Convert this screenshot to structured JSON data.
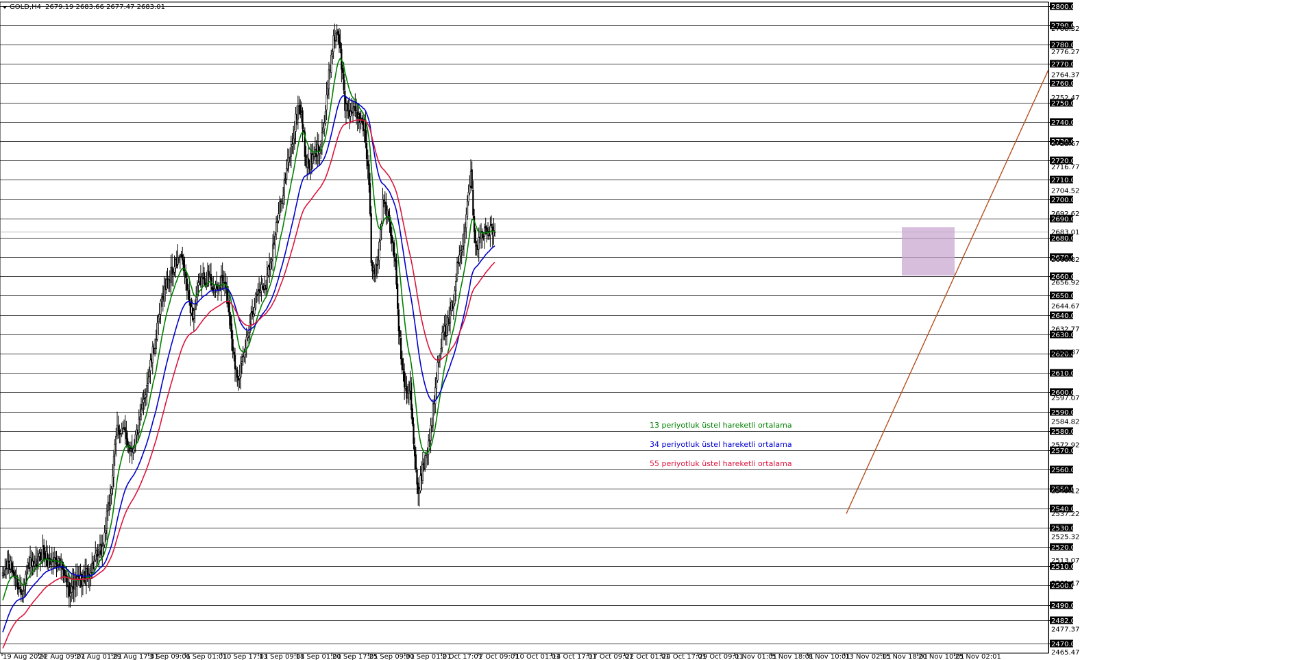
{
  "header": {
    "symbol": "GOLD,H4",
    "ohlc": "2679.19 2683.66 2677.47 2683.01"
  },
  "legend": {
    "ema13": "13 periyotluk üstel hareketli ortalama",
    "ema34": "34 periyotluk üstel hareketli ortalama",
    "ema55": "55 periyotluk üstel hareketli ortalama"
  },
  "colors": {
    "candle": "#000000",
    "ema13": "#008000",
    "ema34": "#0000cd",
    "ema55": "#dc143c",
    "trendline": "#b5501f",
    "zone": "#c8a8d0",
    "grid": "#000000",
    "tag_bg": "#000000",
    "tag_text": "#ffffff"
  },
  "chart_data": {
    "type": "candlestick",
    "ylim": [
      2465,
      2802
    ],
    "y_ticks": [
      2800,
      2790,
      2780,
      2770,
      2760,
      2750,
      2740,
      2730,
      2720,
      2710,
      2700,
      2690,
      2680,
      2670,
      2660,
      2650,
      2640,
      2630,
      2620,
      2610,
      2600,
      2590,
      2580,
      2570,
      2560,
      2550,
      2540,
      2530,
      2520,
      2510,
      2500,
      2490,
      2482,
      2470
    ],
    "y_minor_labels": [
      {
        "value": 2788.32,
        "label": "2788.32"
      },
      {
        "value": 2776.27,
        "label": "2776.27"
      },
      {
        "value": 2764.37,
        "label": "2764.37"
      },
      {
        "value": 2752.47,
        "label": "2752.47"
      },
      {
        "value": 2728.67,
        "label": "2728.67"
      },
      {
        "value": 2716.77,
        "label": "2716.77"
      },
      {
        "value": 2704.52,
        "label": "2704.52"
      },
      {
        "value": 2692.62,
        "label": "2692.62"
      },
      {
        "value": 2683.01,
        "label": "2683.01"
      },
      {
        "value": 2668.82,
        "label": "2668.82"
      },
      {
        "value": 2656.92,
        "label": "2656.92"
      },
      {
        "value": 2644.67,
        "label": "2644.67"
      },
      {
        "value": 2632.77,
        "label": "2632.77"
      },
      {
        "value": 2620.87,
        "label": "2620.87"
      },
      {
        "value": 2597.07,
        "label": "2597.07"
      },
      {
        "value": 2584.82,
        "label": "2584.82"
      },
      {
        "value": 2572.92,
        "label": "2572.92"
      },
      {
        "value": 2549.12,
        "label": "2549.12"
      },
      {
        "value": 2537.22,
        "label": "2537.22"
      },
      {
        "value": 2525.32,
        "label": "2525.32"
      },
      {
        "value": 2513.07,
        "label": "2513.07"
      },
      {
        "value": 2501.17,
        "label": "2501.17"
      },
      {
        "value": 2477.37,
        "label": "2477.37"
      },
      {
        "value": 2465.47,
        "label": "2465.47"
      }
    ],
    "x_labels": [
      "19 Aug 2024",
      "22 Aug 09:01",
      "27 Aug 01:01",
      "29 Aug 17:01",
      "3 Sep 09:01",
      "6 Sep 01:01",
      "10 Sep 17:01",
      "13 Sep 09:01",
      "18 Sep 01:01",
      "20 Sep 17:01",
      "25 Sep 09:01",
      "30 Sep 01:01",
      "2 Oct 17:01",
      "7 Oct 09:01",
      "10 Oct 01:01",
      "14 Oct 17:01",
      "17 Oct 09:01",
      "22 Oct 01:01",
      "24 Oct 17:01",
      "29 Oct 09:01",
      "1 Nov 01:01",
      "5 Nov 18:01",
      "8 Nov 10:01",
      "13 Nov 02:01",
      "15 Nov 18:01",
      "20 Nov 10:01",
      "25 Nov 02:01"
    ],
    "x_label_spacing_bars": 16,
    "bar_count": 431,
    "close_anchors": [
      [
        0,
        2503
      ],
      [
        8,
        2512
      ],
      [
        20,
        2506
      ],
      [
        32,
        2496
      ],
      [
        45,
        2512
      ],
      [
        55,
        2508
      ],
      [
        70,
        2518
      ],
      [
        80,
        2512
      ],
      [
        95,
        2514
      ],
      [
        105,
        2507
      ],
      [
        115,
        2498
      ],
      [
        125,
        2502
      ],
      [
        135,
        2502
      ],
      [
        150,
        2506
      ],
      [
        160,
        2512
      ],
      [
        175,
        2520
      ],
      [
        190,
        2552
      ],
      [
        200,
        2582
      ],
      [
        210,
        2580
      ],
      [
        225,
        2570
      ],
      [
        240,
        2585
      ],
      [
        255,
        2610
      ],
      [
        268,
        2628
      ],
      [
        280,
        2652
      ],
      [
        295,
        2662
      ],
      [
        310,
        2670
      ],
      [
        318,
        2662
      ],
      [
        325,
        2648
      ],
      [
        332,
        2640
      ],
      [
        345,
        2658
      ],
      [
        360,
        2660
      ],
      [
        372,
        2652
      ],
      [
        385,
        2658
      ],
      [
        395,
        2645
      ],
      [
        405,
        2615
      ],
      [
        412,
        2610
      ],
      [
        420,
        2616
      ],
      [
        432,
        2638
      ],
      [
        445,
        2652
      ],
      [
        460,
        2657
      ],
      [
        475,
        2680
      ],
      [
        490,
        2705
      ],
      [
        505,
        2728
      ],
      [
        516,
        2748
      ],
      [
        522,
        2745
      ],
      [
        530,
        2718
      ],
      [
        540,
        2720
      ],
      [
        553,
        2727
      ],
      [
        563,
        2742
      ],
      [
        575,
        2778
      ],
      [
        585,
        2790
      ],
      [
        592,
        2770
      ],
      [
        598,
        2748
      ],
      [
        610,
        2745
      ],
      [
        625,
        2742
      ],
      [
        632,
        2738
      ],
      [
        640,
        2708
      ],
      [
        645,
        2660
      ],
      [
        655,
        2668
      ],
      [
        665,
        2700
      ],
      [
        675,
        2688
      ],
      [
        685,
        2670
      ],
      [
        695,
        2620
      ],
      [
        705,
        2600
      ],
      [
        712,
        2605
      ],
      [
        718,
        2575
      ],
      [
        726,
        2545
      ],
      [
        734,
        2562
      ],
      [
        742,
        2570
      ],
      [
        752,
        2590
      ],
      [
        760,
        2618
      ],
      [
        770,
        2630
      ],
      [
        780,
        2636
      ],
      [
        788,
        2650
      ],
      [
        796,
        2668
      ],
      [
        804,
        2676
      ],
      [
        812,
        2702
      ],
      [
        818,
        2715
      ],
      [
        823,
        2690
      ],
      [
        828,
        2672
      ],
      [
        832,
        2683
      ]
    ],
    "series": [
      {
        "name": "13 periyotluk üstel hareketli ortalama",
        "period": 13
      },
      {
        "name": "34 periyotluk üstel hareketli ortalama",
        "period": 34
      },
      {
        "name": "55 periyotluk üstel hareketli ortalama",
        "period": 55
      }
    ],
    "current_price": 2683.01,
    "trendline": [
      {
        "date": "13 Nov 02:01",
        "price": 2537.22
      },
      {
        "date": "right edge",
        "price": 2767
      }
    ],
    "zone": {
      "price_top": 2685.5,
      "price_bottom": 2660.5
    }
  }
}
